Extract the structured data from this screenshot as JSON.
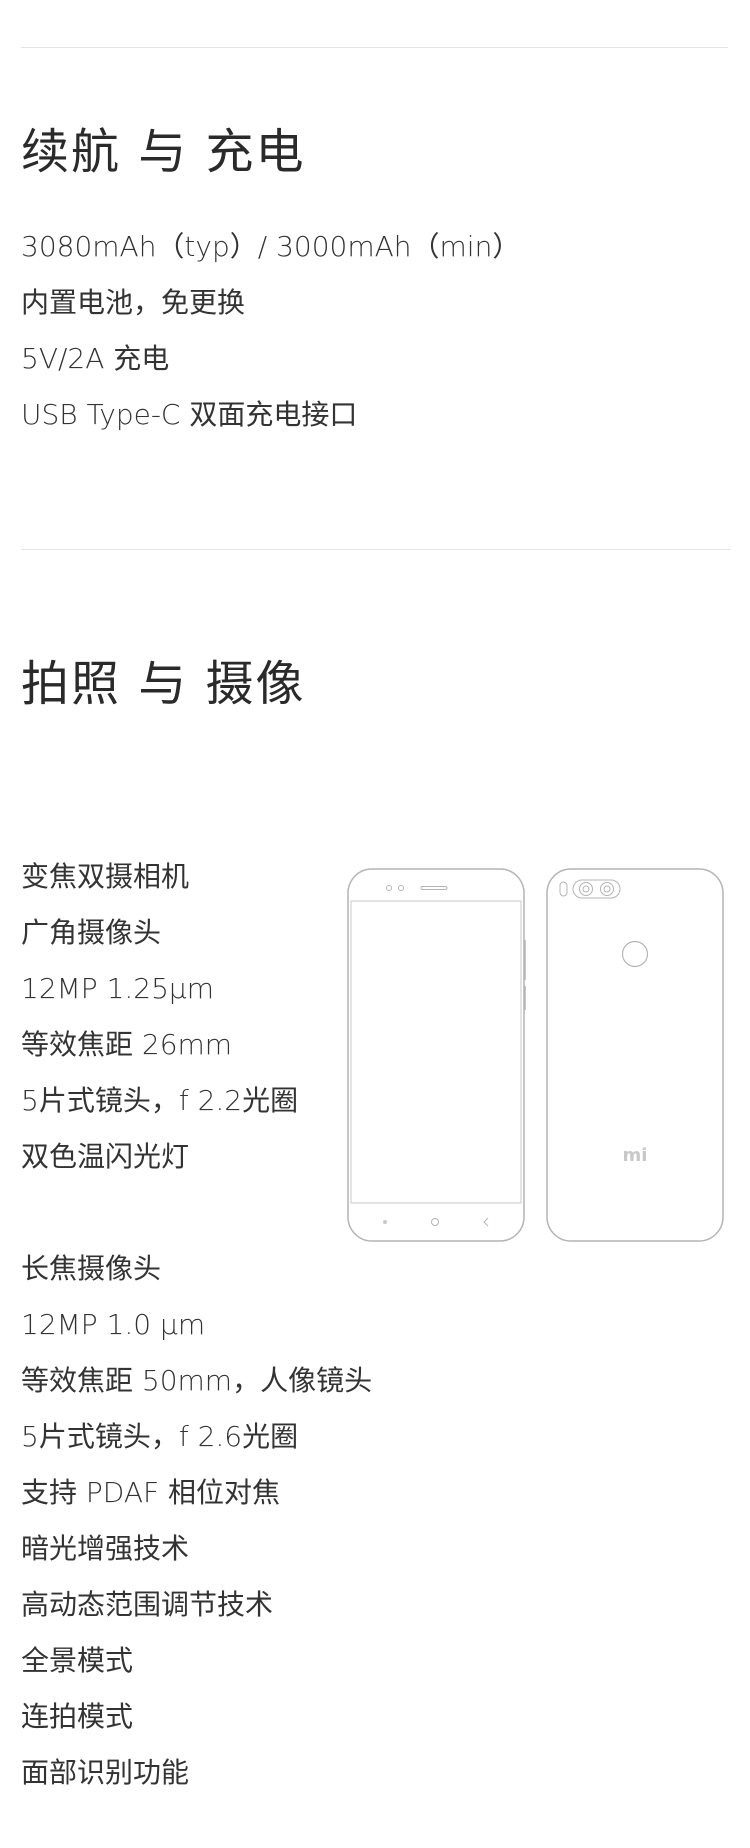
{
  "battery": {
    "title": "续航 与 充电",
    "specs": [
      "3080mAh（typ）/ 3000mAh（min）",
      "内置电池，免更换",
      "5V/2A 充电",
      "USB Type-C 双面充电接口"
    ]
  },
  "camera": {
    "title": "拍照 与 摄像",
    "wide_specs": [
      "变焦双摄相机",
      "广角摄像头",
      "12MP 1.25μm",
      "等效焦距 26mm",
      "5片式镜头，f 2.2光圈",
      "双色温闪光灯"
    ],
    "tele_specs": [
      "长焦摄像头",
      "12MP 1.0 μm",
      "等效焦距 50mm，人像镜头",
      "5片式镜头，f 2.6光圈",
      "支持 PDAF 相位对焦",
      "暗光增强技术",
      "高动态范围调节技术",
      "全景模式",
      "连拍模式",
      "面部识别功能"
    ],
    "back_logo": "mi"
  },
  "colors": {
    "text": "#333333",
    "divider": "#e4e4e4",
    "outline": "#b4b4b4"
  }
}
